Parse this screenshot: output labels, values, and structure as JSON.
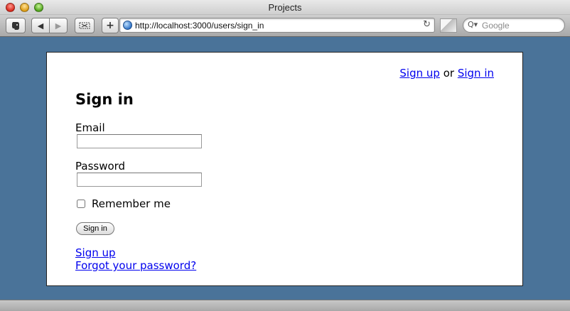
{
  "window": {
    "title": "Projects"
  },
  "toolbar": {
    "back_label": "◀",
    "forward_label": "▶",
    "add_label": "+",
    "url": "http://localhost:3000/users/sign_in",
    "search_placeholder": "Google"
  },
  "page": {
    "userbar": {
      "signup_label": "Sign up",
      "separator": "or",
      "signin_label": "Sign in"
    },
    "heading": "Sign in",
    "email_label": "Email",
    "email_value": "",
    "password_label": "Password",
    "password_value": "",
    "remember_label": "Remember me",
    "remember_checked": false,
    "submit_label": "Sign in",
    "footer_links": {
      "signup": "Sign up",
      "forgot": "Forgot your password?"
    }
  },
  "colors": {
    "background": "#4a7399",
    "link": "#0000ee"
  }
}
